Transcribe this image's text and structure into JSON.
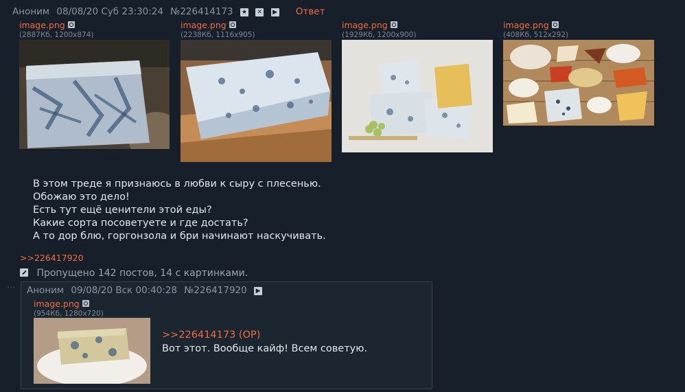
{
  "op": {
    "author": "Аноним",
    "date": "08/08/20 Суб 23:30:24",
    "number": "№226414173",
    "icon_star": "star-icon",
    "icon_hide": "close-icon",
    "icon_play": "play-icon",
    "reply_label": "Ответ",
    "files": [
      {
        "name": "image.png",
        "meta": "(2887Кб, 1200x874)"
      },
      {
        "name": "image.png",
        "meta": "(2238Кб, 1116x905)"
      },
      {
        "name": "image.png",
        "meta": "(1929Кб, 1200x900)"
      },
      {
        "name": "image.png",
        "meta": "(408Кб, 512x292)"
      }
    ],
    "message": [
      "В этом треде я признаюсь в любви к сыру с плесенью.",
      "Обожаю это дело!",
      "Есть тут ещё ценители этой еды?",
      "Какие сорта посоветуете и где достать?",
      "А то дор блю, горгонзола и бри начинают наскучивать."
    ],
    "backlink": ">>226417920"
  },
  "skipped": "Пропущено 142 постов, 14 с картинками.",
  "reply_post": {
    "author": "Аноним",
    "date": "09/08/20 Вск 00:40:28",
    "number": "№226417920",
    "file": {
      "name": "image.png",
      "meta": "(954Кб, 1280x720)"
    },
    "quote": ">>226414173 (OP)",
    "text": "Вот этот. Вообще кайф! Всем советую."
  },
  "colors": {
    "background": "#17202a",
    "accent": "#f26d3d",
    "text": "#e3e8ee"
  }
}
